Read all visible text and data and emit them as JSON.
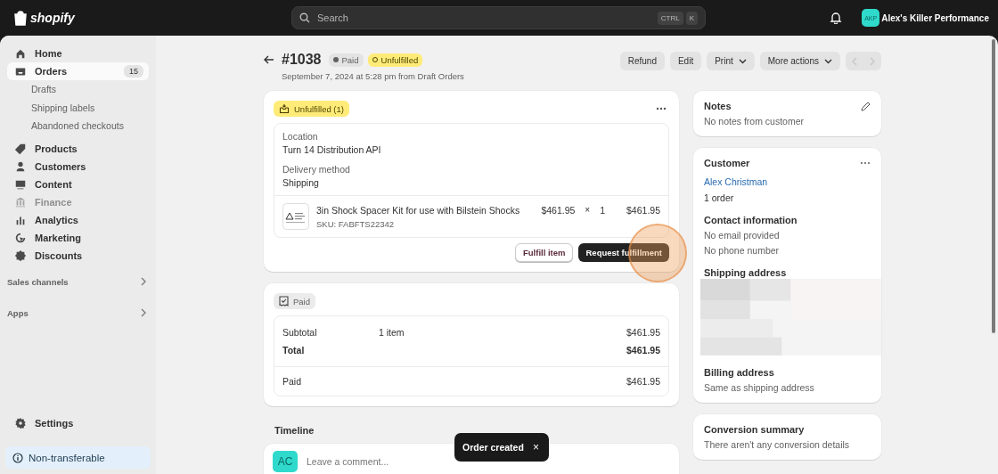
{
  "topbar": {
    "brand": "shopify",
    "search": {
      "placeholder": "Search",
      "keys": [
        "CTRL",
        "K"
      ]
    },
    "store": {
      "initials": "AKP",
      "name": "Alex's Killer Performance"
    }
  },
  "sidebar": {
    "items": [
      {
        "label": "Home",
        "selected": false,
        "disabled": false
      },
      {
        "label": "Orders",
        "selected": true,
        "disabled": false,
        "badge": "15",
        "children": [
          {
            "label": "Drafts",
            "selected": false
          },
          {
            "label": "Shipping labels",
            "selected": false
          },
          {
            "label": "Abandoned checkouts",
            "selected": false
          }
        ]
      },
      {
        "label": "Products",
        "selected": false,
        "disabled": false
      },
      {
        "label": "Customers",
        "selected": false,
        "disabled": false
      },
      {
        "label": "Content",
        "selected": false,
        "disabled": false
      },
      {
        "label": "Finance",
        "selected": false,
        "disabled": true
      },
      {
        "label": "Analytics",
        "selected": false,
        "disabled": false
      },
      {
        "label": "Marketing",
        "selected": false,
        "disabled": false
      },
      {
        "label": "Discounts",
        "selected": false,
        "disabled": false
      }
    ],
    "sections": [
      "Sales channels",
      "Apps"
    ],
    "settings": "Settings",
    "plan_notice": "Non-transferable"
  },
  "order": {
    "title": "#1038",
    "badges": [
      {
        "label": "Paid",
        "kind": "paid"
      },
      {
        "label": "Unfulfilled",
        "kind": "unfulfilled"
      }
    ],
    "subtitle": "September 7, 2024 at 5:28 pm from Draft Orders",
    "actions": [
      {
        "label": "Refund",
        "kind": "button"
      },
      {
        "label": "Edit",
        "kind": "button"
      },
      {
        "label": "Print",
        "kind": "menu"
      },
      {
        "label": "More actions",
        "kind": "menu"
      }
    ],
    "pager": {
      "disabled": true
    }
  },
  "fulfillment": {
    "badge": "Unfulfilled (1)",
    "location_label": "Location",
    "location": "Turn 14 Distribution API",
    "delivery_label": "Delivery method",
    "delivery": "Shipping",
    "item": {
      "name": "3in Shock Spacer Kit for use with Bilstein Shocks",
      "sku": "SKU: FABFTS22342",
      "price": "$461.95",
      "times": "×",
      "quantity": "1",
      "total": "$461.95"
    },
    "buttons": [
      {
        "label": "Fulfill item",
        "kind": "secondary"
      },
      {
        "label": "Request fulfillment",
        "kind": "primary"
      }
    ]
  },
  "payment": {
    "badge": "Paid",
    "rows": [
      {
        "label": "Subtotal",
        "detail": "1 item",
        "amount": "$461.95",
        "kind": "line"
      },
      {
        "label": "Total",
        "amount": "$461.95",
        "kind": "total"
      }
    ],
    "paid": {
      "label": "Paid",
      "amount": "$461.95"
    }
  },
  "timeline": {
    "heading": "Timeline",
    "avatar": "AC",
    "placeholder": "Leave a comment..."
  },
  "notes": {
    "heading": "Notes",
    "text": "No notes from customer"
  },
  "customer": {
    "heading": "Customer",
    "name": "Alex Christman",
    "orders": "1 order",
    "contact_heading": "Contact information",
    "contact": [
      "No email provided",
      "No phone number"
    ],
    "shipping_heading": "Shipping address",
    "billing_heading": "Billing address",
    "billing": "Same as shipping address"
  },
  "conversion": {
    "heading": "Conversion summary",
    "text": "There aren't any conversion details"
  },
  "toast": {
    "message": "Order created",
    "close": "×"
  }
}
